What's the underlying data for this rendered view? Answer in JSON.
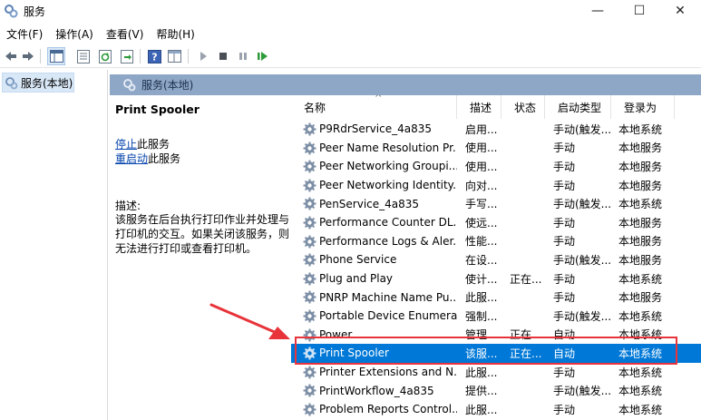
{
  "window": {
    "title": "服务",
    "controls": {
      "minimize": "—",
      "maximize": "☐",
      "close": "✕"
    }
  },
  "menu": [
    "文件(F)",
    "操作(A)",
    "查看(V)",
    "帮助(H)"
  ],
  "toolbar_icons": [
    "back-arrow-icon",
    "forward-arrow-icon",
    "console-tree-icon",
    "properties-icon",
    "refresh-icon",
    "export-list-icon",
    "help-icon",
    "extended-view-icon",
    "play-icon",
    "stop-icon",
    "pause-icon",
    "restart-icon"
  ],
  "tree": {
    "item": "服务(本地)"
  },
  "panel": {
    "header": "服务(本地)"
  },
  "details": {
    "service_name": "Print Spooler",
    "stop_link": "停止",
    "stop_suffix": "此服务",
    "restart_link": "重启动",
    "restart_suffix": "此服务",
    "desc_label": "描述:",
    "desc_text": "该服务在后台执行打印作业并处理与打印机的交互。如果关闭该服务，则无法进行打印或查看打印机。"
  },
  "table": {
    "columns": [
      "名称",
      "描述",
      "状态",
      "启动类型",
      "登录为"
    ],
    "sort_caret": "^",
    "rows": [
      {
        "name": "P9RdrService_4a835",
        "desc": "启用...",
        "status": "",
        "start": "手动(触发...",
        "logon": "本地系统"
      },
      {
        "name": "Peer Name Resolution Pr...",
        "desc": "使用...",
        "status": "",
        "start": "手动",
        "logon": "本地服务"
      },
      {
        "name": "Peer Networking Groupi...",
        "desc": "使用...",
        "status": "",
        "start": "手动",
        "logon": "本地服务"
      },
      {
        "name": "Peer Networking Identity...",
        "desc": "向对...",
        "status": "",
        "start": "手动",
        "logon": "本地服务"
      },
      {
        "name": "PenService_4a835",
        "desc": "手写...",
        "status": "",
        "start": "手动(触发...",
        "logon": "本地系统"
      },
      {
        "name": "Performance Counter DL...",
        "desc": "使远...",
        "status": "",
        "start": "手动",
        "logon": "本地服务"
      },
      {
        "name": "Performance Logs & Aler...",
        "desc": "性能...",
        "status": "",
        "start": "手动",
        "logon": "本地服务"
      },
      {
        "name": "Phone Service",
        "desc": "在设...",
        "status": "",
        "start": "手动(触发...",
        "logon": "本地服务"
      },
      {
        "name": "Plug and Play",
        "desc": "使计...",
        "status": "正在...",
        "start": "手动",
        "logon": "本地系统"
      },
      {
        "name": "PNRP Machine Name Pu...",
        "desc": "此服...",
        "status": "",
        "start": "手动",
        "logon": "本地服务"
      },
      {
        "name": "Portable Device Enumera...",
        "desc": "强制...",
        "status": "",
        "start": "手动(触发...",
        "logon": "本地系统"
      },
      {
        "name": "Power",
        "desc": "管理...",
        "status": "正在...",
        "start": "自动",
        "logon": "本地系统"
      },
      {
        "name": "Print Spooler",
        "desc": "该服...",
        "status": "正在...",
        "start": "自动",
        "logon": "本地系统",
        "selected": true
      },
      {
        "name": "Printer Extensions and N...",
        "desc": "此服...",
        "status": "",
        "start": "手动",
        "logon": "本地系统"
      },
      {
        "name": "PrintWorkflow_4a835",
        "desc": "提供...",
        "status": "",
        "start": "手动(触发...",
        "logon": "本地系统"
      },
      {
        "name": "Problem Reports Control...",
        "desc": "此服...",
        "status": "",
        "start": "手动",
        "logon": "本地系统"
      }
    ]
  },
  "colors": {
    "selection": "#0078d7",
    "panel_header": "#8fa7c6",
    "annotation": "#e8333a",
    "link": "#0645ad"
  }
}
